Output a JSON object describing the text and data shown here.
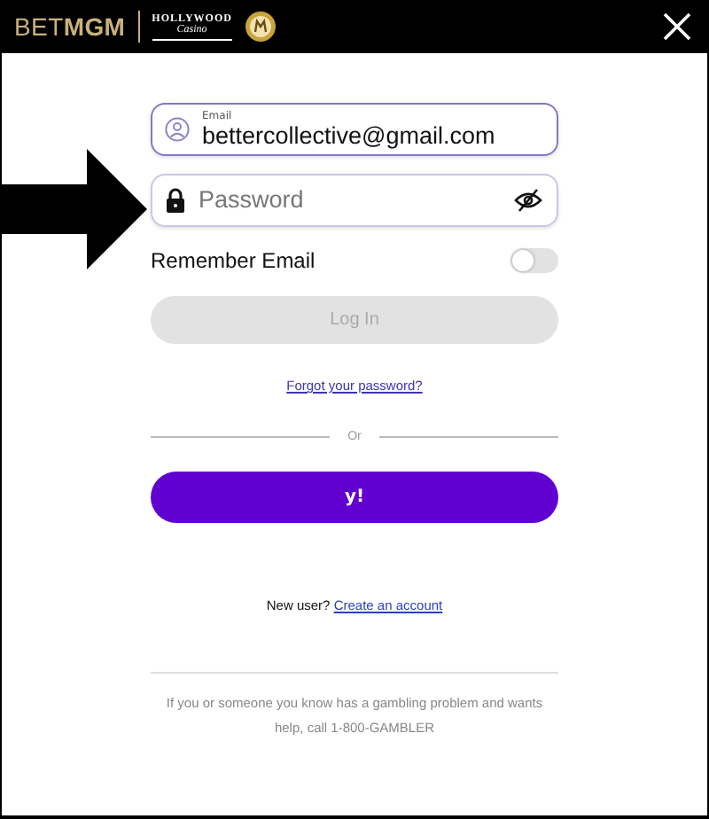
{
  "header": {
    "brand": "BET**MGM**",
    "partner": {
      "line1": "HOLLYWOOD",
      "line2": "Casino"
    }
  },
  "email_field": {
    "label": "Email",
    "value": "bettercollective@gmail.com"
  },
  "password_field": {
    "placeholder": "Password"
  },
  "remember_email": {
    "label": "Remember Email",
    "on": false
  },
  "login_button": {
    "label": "Log In",
    "disabled": true
  },
  "forgot_link": "Forgot your password?",
  "divider_label": "Or",
  "yahoo_button": {
    "label": "y!"
  },
  "new_user": {
    "prompt": "New user?",
    "link": "Create an account"
  },
  "footer": "If you or someone you know has a gambling problem and wants help, call 1-800-GAMBLER"
}
